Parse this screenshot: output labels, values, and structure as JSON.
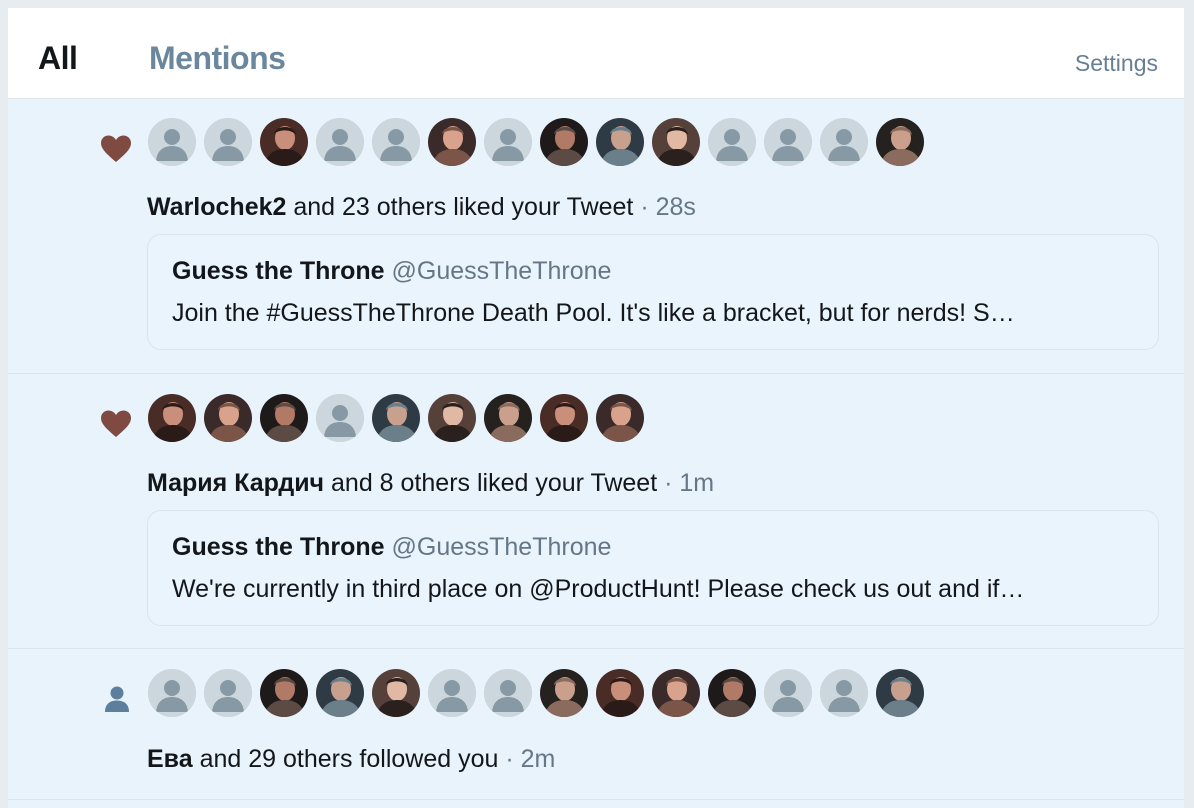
{
  "tabs": {
    "all": "All",
    "mentions": "Mentions",
    "settings": "Settings"
  },
  "notifications": [
    {
      "type": "like",
      "icon": "heart-icon",
      "icon_color": "#7e4a42",
      "avatars": [
        "default",
        "default",
        "photo",
        "default",
        "default",
        "photo",
        "default",
        "photo",
        "photo",
        "photo",
        "default",
        "default",
        "default",
        "photo"
      ],
      "name": "Warlochek2",
      "action": " and 23 others liked your Tweet",
      "dot": " · ",
      "time": "28s",
      "quote": {
        "name": "Guess the Throne",
        "handle": " @GuessTheThrone",
        "text": "Join the #GuessTheThrone Death Pool. It's like a bracket, but for nerds! S…"
      }
    },
    {
      "type": "like",
      "icon": "heart-icon",
      "icon_color": "#7e4a42",
      "avatars": [
        "photo",
        "photo",
        "photo",
        "default",
        "photo",
        "photo",
        "photo",
        "photo",
        "photo"
      ],
      "name": "Мария Кардич",
      "action": " and 8 others liked your Tweet",
      "dot": " · ",
      "time": "1m",
      "quote": {
        "name": "Guess the Throne",
        "handle": " @GuessTheThrone",
        "text": "We're currently in third place on @ProductHunt! Please check us out and if…"
      }
    },
    {
      "type": "follow",
      "icon": "person-icon",
      "icon_color": "#5b7f9c",
      "avatars": [
        "default",
        "default",
        "photo",
        "photo",
        "photo",
        "default",
        "default",
        "photo",
        "photo",
        "photo",
        "photo",
        "default",
        "default",
        "photo"
      ],
      "name": "Ева",
      "action": " and 29 others followed you",
      "dot": " · ",
      "time": "2m"
    }
  ]
}
